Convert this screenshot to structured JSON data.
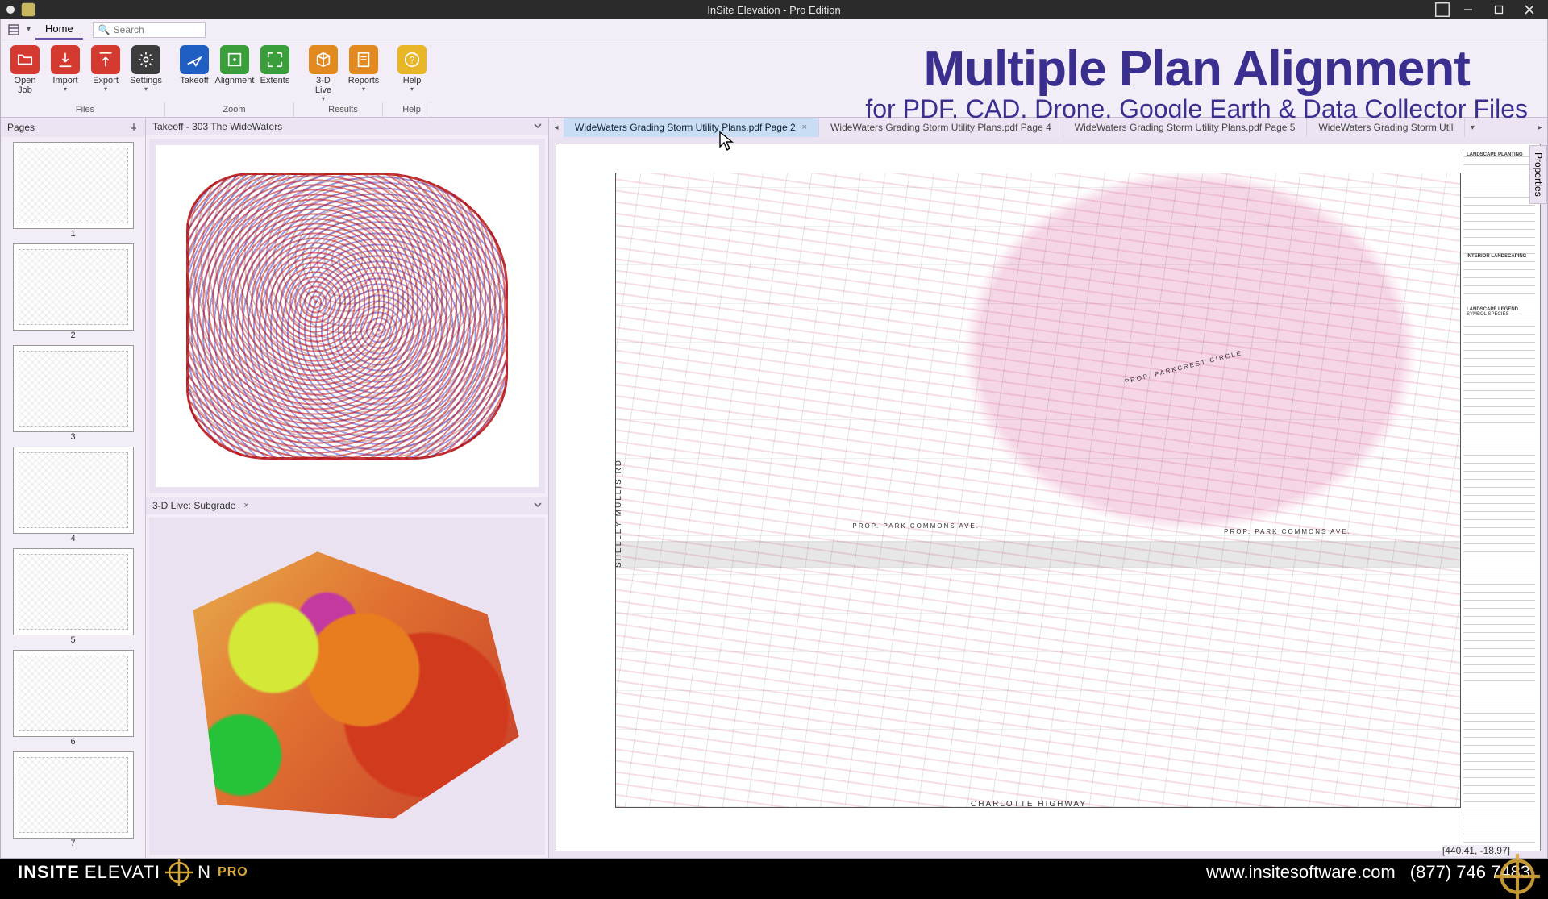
{
  "window": {
    "title": "InSite Elevation - Pro Edition"
  },
  "qat": {
    "tab_home": "Home",
    "search_placeholder": "Search"
  },
  "ribbon": {
    "groups": {
      "files": "Files",
      "zoom": "Zoom",
      "results": "Results",
      "help": "Help"
    },
    "buttons": {
      "open_job": "Open\nJob",
      "import": "Import",
      "export": "Export",
      "settings": "Settings",
      "takeoff": "Takeoff",
      "alignment": "Alignment",
      "extents": "Extents",
      "live3d": "3-D\nLive",
      "reports": "Reports",
      "help": "Help"
    }
  },
  "marketing": {
    "title": "Multiple Plan Alignment",
    "subtitle": "for PDF, CAD, Drone, Google Earth & Data Collector Files"
  },
  "pages": {
    "header": "Pages",
    "labels": [
      "1",
      "2",
      "3",
      "4",
      "5",
      "6",
      "7"
    ]
  },
  "views": {
    "takeoff": "Takeoff - 303 The WideWaters",
    "live3d": "3-D Live: Subgrade"
  },
  "doctabs": {
    "t2": "WideWaters Grading Storm Utility Plans.pdf Page 2",
    "t4": "WideWaters Grading Storm Utility Plans.pdf Page 4",
    "t5": "WideWaters Grading Storm Utility Plans.pdf Page 5",
    "t6": "WideWaters Grading Storm Util"
  },
  "sheet": {
    "road_bottom": "CHARLOTTE HIGHWAY",
    "road_left": "SHELLEY MULLIS RD",
    "road_mid1": "PROP. PARK COMMONS AVE.",
    "road_mid2": "PROP. PARKCREST CIRCLE",
    "road_mid3": "PROP. PARK COMMONS AVE.",
    "legend_title": "LANDSCAPE PLANTING",
    "legend2": "INTERIOR LANDSCAPING",
    "legend3": "LANDSCAPE LEGEND",
    "legend4": "SYMBOL   SPECIES"
  },
  "properties_tab": "Properties",
  "status": {
    "coords": "[440.41, -18.97]"
  },
  "footer": {
    "brand1": "INSITE",
    "brand2": "ELEVATI",
    "brand3": "N",
    "pro": "PRO",
    "url": "www.insitesoftware.com",
    "phone": "(877) 746 7483"
  }
}
